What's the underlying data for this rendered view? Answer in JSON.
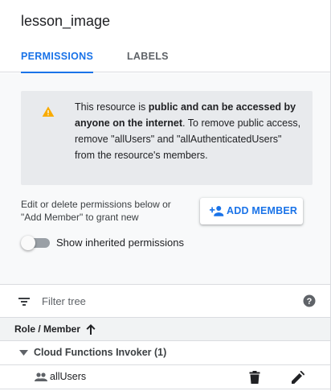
{
  "panel": {
    "title": "lesson_image"
  },
  "tabs": [
    {
      "label": "PERMISSIONS",
      "active": true
    },
    {
      "label": "LABELS",
      "active": false
    }
  ],
  "warning": {
    "icon": "warning-triangle-icon",
    "text_pre": "This resource is ",
    "text_bold": "public and can be accessed by anyone on the internet",
    "text_post": ". To remove public access, remove \"allUsers\" and \"allAuthenticatedUsers\" from the resource's members."
  },
  "hint": "Edit or delete permissions below or \"Add Member\" to grant new",
  "add_member": {
    "label": "ADD MEMBER",
    "icon": "person-add-icon"
  },
  "inherited_toggle": {
    "label": "Show inherited permissions",
    "on": false
  },
  "filter": {
    "placeholder": "Filter tree",
    "value": ""
  },
  "table": {
    "header": "Role / Member",
    "sort": "ascending",
    "groups": [
      {
        "label": "Cloud Functions Invoker (1)",
        "expanded": true,
        "members": [
          {
            "name": "allUsers",
            "icon": "people-icon"
          }
        ]
      }
    ]
  },
  "colors": {
    "accent": "#1a73e8",
    "warning": "#f9ab00",
    "background": "#f8f9fa"
  }
}
